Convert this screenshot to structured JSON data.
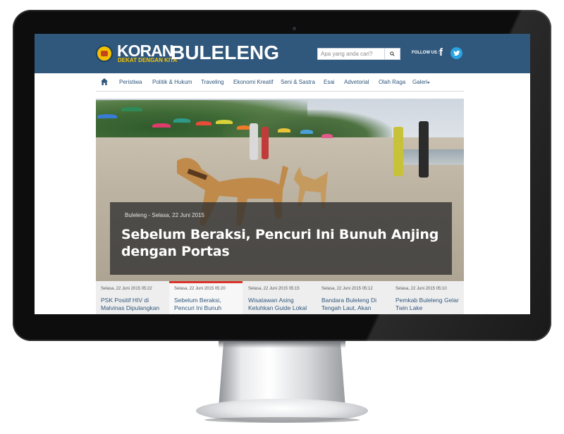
{
  "site": {
    "logo_koran": "KORAN",
    "logo_buleleng": "BULELENG",
    "logo_tagline": "DEKAT DENGAN KITA"
  },
  "header": {
    "search_placeholder": "Apa yang anda cari?",
    "follow_label": "FOLLOW US :",
    "facebook_glyph": "f",
    "header_color": "#30577c"
  },
  "nav": {
    "items": [
      "Peristiwa",
      "Politik & Hukum",
      "Traveling",
      "Ekonomi Kreatif",
      "Seni & Sastra",
      "Esai",
      "Advetorial",
      "Olah Raga",
      "Galeri"
    ]
  },
  "hero": {
    "meta": "Buleleng - Selasa, 22 Juni 2015",
    "title": "Sebelum Beraksi, Pencuri Ini Bunuh Anjing dengan Portas"
  },
  "news": [
    {
      "date": "Selasa, 22 Juni 2015 05:22",
      "title": "PSK Positif HIV di Malvinas Dipulangkan"
    },
    {
      "date": "Selasa, 22 Juni 2015 05:20",
      "title": "Sebelum Beraksi, Pencuri Ini Bunuh"
    },
    {
      "date": "Selasa, 22 Juni 2015 05:15",
      "title": "Wisatawan Asing Keluhkan Guide Lokal"
    },
    {
      "date": "Selasa, 22 Juni 2015 05:12",
      "title": "Bandara Buleleng Di Tengah Laut, Akan"
    },
    {
      "date": "Selasa, 22 Juni 2015 05:10",
      "title": "Pemkab Buleleng Gelar Twin Lake"
    }
  ],
  "colors": {
    "accent_red": "#d9332b",
    "twitter": "#2aa3e0",
    "logo_yellow": "#f5c400"
  }
}
